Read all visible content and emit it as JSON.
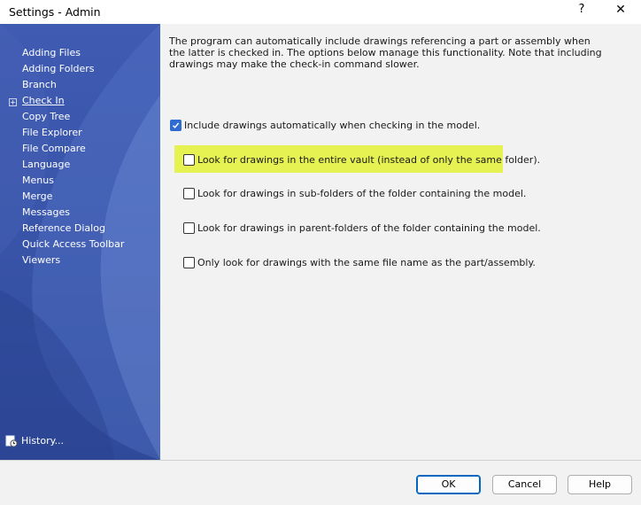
{
  "window": {
    "title": "Settings - Admin",
    "help_glyph": "?",
    "close_glyph": "✕"
  },
  "sidebar": {
    "items": [
      {
        "label": "Adding Files"
      },
      {
        "label": "Adding Folders"
      },
      {
        "label": "Branch"
      },
      {
        "label": "Check In"
      },
      {
        "label": "Copy Tree"
      },
      {
        "label": "File Explorer"
      },
      {
        "label": "File Compare"
      },
      {
        "label": "Language"
      },
      {
        "label": "Menus"
      },
      {
        "label": "Merge"
      },
      {
        "label": "Messages"
      },
      {
        "label": "Reference Dialog"
      },
      {
        "label": "Quick Access Toolbar"
      },
      {
        "label": "Viewers"
      }
    ],
    "active_item": "Check In",
    "expander_glyph": "+",
    "history_label": "History..."
  },
  "content": {
    "description": "The program can automatically include drawings referencing a part or assembly when the latter is checked in. The options below manage this functionality. Note that including drawings may make the check-in command slower.",
    "options": [
      {
        "label": "Include drawings automatically when checking in the model.",
        "checked": true
      },
      {
        "label": "Look for drawings in the entire vault (instead of only the same folder).",
        "checked": false
      },
      {
        "label": "Look for drawings in sub-folders of the folder containing the model.",
        "checked": false
      },
      {
        "label": "Look for drawings in parent-folders of the folder containing the model.",
        "checked": false
      },
      {
        "label": "Only look for drawings with the same file name as the part/assembly.",
        "checked": false
      }
    ],
    "highlight_color": "#e6f152"
  },
  "footer": {
    "ok_label": "OK",
    "cancel_label": "Cancel",
    "help_label": "Help"
  }
}
